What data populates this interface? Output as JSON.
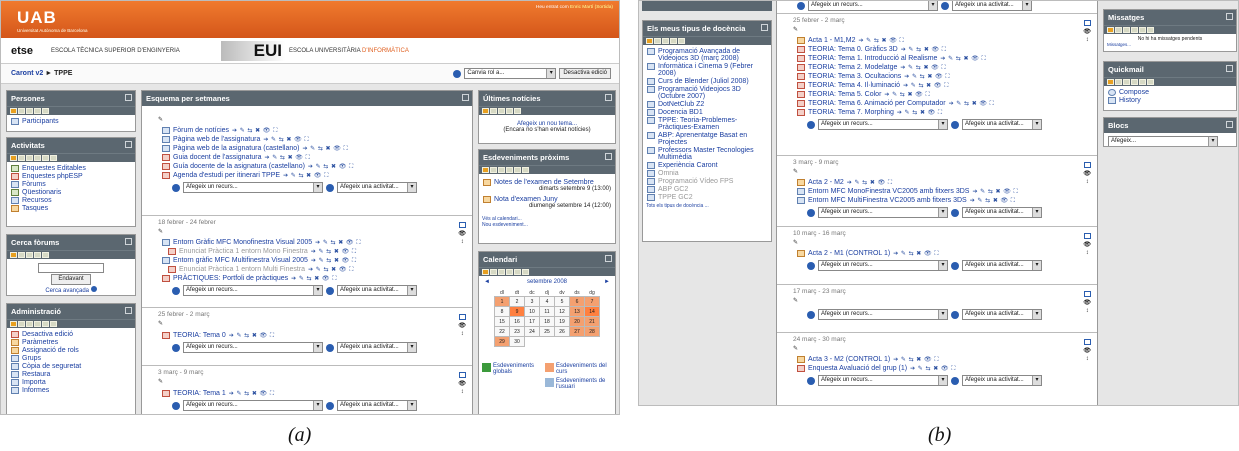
{
  "screens": {
    "a_caption": "(a)",
    "b_caption": "(b)"
  },
  "header": {
    "uab": "UAB",
    "uab_sub": "Universitat Autònoma de Barcelona",
    "welcome": "Heu entrat com",
    "user": "Enric Martí",
    "logout": "(Sortida)",
    "etse_logo": "etse",
    "etse_text": "ESCOLA TÈCNICA SUPERIOR D'ENGINYERIA",
    "eui_logo": "EUI",
    "eui_text": "ESCOLA UNIVERSITÀRIA",
    "eui_text_hl": "D'INFORMÀTICA"
  },
  "nav": {
    "home": "Caront v2",
    "arrow": "►",
    "course": "TPPE",
    "role_select": "Canvia rol a...",
    "edit_button": "Desactiva edició"
  },
  "blocks": {
    "persones": {
      "title": "Persones",
      "items": [
        "Participants"
      ]
    },
    "activitats": {
      "title": "Activitats",
      "items": [
        "Enquestes Editables",
        "Enquestes phpESP",
        "Fòrums",
        "Qüestionaris",
        "Recursos",
        "Tasques"
      ]
    },
    "cerca": {
      "title": "Cerca fòrums",
      "button": "Endavant",
      "advanced": "Cerca avançada"
    },
    "admin": {
      "title": "Administració",
      "items": [
        "Desactiva edició",
        "Paràmetres",
        "Assignació de rols",
        "Grups",
        "Còpia de seguretat",
        "Restaura",
        "Importa",
        "Informes"
      ]
    },
    "noticies": {
      "title": "Últimes notícies",
      "add": "Afegeix un nou tema...",
      "none": "(Encara no s'han enviat notícies)"
    },
    "esdev": {
      "title": "Esdeveniments pròxims",
      "e1": "Notes de l'examen de Setembre",
      "e1d": "dimarts setembre 9 (13:00)",
      "e2": "Nota d'examen Juny",
      "e2d": "diumenge setembre 14 (12:00)",
      "cal_link": "Vés al calendari...",
      "new_link": "Nou esdeveniment..."
    },
    "calendari": {
      "title": "Calendari",
      "prev": "◄",
      "month": "setembre 2008",
      "next": "►",
      "days": [
        "dl",
        "dt",
        "dc",
        "dj",
        "dv",
        "ds",
        "dg"
      ],
      "weeks": [
        [
          "1",
          "2",
          "3",
          "4",
          "5",
          "6",
          "7"
        ],
        [
          "8",
          "9",
          "10",
          "11",
          "12",
          "13",
          "14"
        ],
        [
          "15",
          "16",
          "17",
          "18",
          "19",
          "20",
          "21"
        ],
        [
          "22",
          "23",
          "24",
          "25",
          "26",
          "27",
          "28"
        ],
        [
          "29",
          "30",
          "",
          "",
          "",
          "",
          ""
        ]
      ],
      "legend_global": "Esdeveniments globals",
      "legend_course": "Esdeveniments del curs",
      "legend_user": "Esdeveniments de l'usuari"
    }
  },
  "main": {
    "title": "Esquema per setmanes",
    "acts": "➔ ✎ ⇆ ✖ 👁 ⛶",
    "add_resource": "Afegeix un recurs...",
    "add_activity": "Afegeix una activitat...",
    "intro": [
      "Fòrum de notícies",
      "Pàgina web de l'assignatura",
      "Pàgina web de la asignatura (castellano)",
      "Guia docent de l'assignatura",
      "Guía docente de la asignatura (castellano)",
      "Agenda d'estudi per itinerari TPPE"
    ],
    "w1": {
      "date": "18 febrer - 24 febrer",
      "items": [
        "Entorn Gràfic MFC Monofinestra Visual 2005",
        "Enunciat Pràctica 1 entorn Mono Finestra",
        "Entorn gràfic MFC Multifinestra Visual 2005",
        "Enunciat Pràctica 1 entorn Multi Finestra",
        "PRÀCTIQUES: Portfoli de pràctiques"
      ]
    },
    "w2": {
      "date": "25 febrer - 2 març",
      "items": [
        "TEORIA: Tema 0"
      ]
    },
    "w3": {
      "date": "3 març - 9 març",
      "items": [
        "TEORIA: Tema 1"
      ]
    }
  },
  "b": {
    "tipus": {
      "title": "Els meus tipus de docència",
      "items": [
        "Programació Avançada de Videojocs 3D (març 2008)",
        "Informàtica i Cinema 9 (Febrer 2008)",
        "Curs de Blender (Juliol 2008)",
        "Programació Videojocs 3D (Octubre 2007)",
        "DotNetClub Z2",
        "Docencia BD1",
        "TPPE: Teoria-Problemes-Pràctiques-Examen",
        "ABP: Aprenentatge Basat en Projectes",
        "Professors Master Tecnologies Multimèdia",
        "Experiència Caront",
        "Omnia",
        "Programació Vídeo FPS",
        "ABP GC2",
        "TPPE GC2"
      ],
      "all": "Tots els tipus de docència ..."
    },
    "w1": {
      "date": "25 febrer - 2 març",
      "items": [
        "Acta 1 - M1,M2",
        "TEORIA: Tema 0. Gràfics 3D",
        "TEORIA: Tema 1. Introducció al Realisme",
        "TEORIA: Tema 2. Modelatge",
        "TEORIA: Tema 3. Ocultacions",
        "TEORIA: Tema 4. Il·luminació",
        "TEORIA: Tema 5. Color",
        "TEORIA: Tema 6. Animació per Computador",
        "TEORIA: Tema 7. Morphing"
      ]
    },
    "w2": {
      "date": "3 març - 9 març",
      "items": [
        "Acta 2 - M2",
        "Entorn MFC MonoFinestra VC2005 amb fitxers 3DS",
        "Entorn MFC MultiFinestra VC2005 amb fitxers 3DS"
      ]
    },
    "w3": {
      "date": "10 març - 16 març",
      "items": [
        "Acta 2 - M1 (CONTROL 1)"
      ]
    },
    "w4": {
      "date": "17 març - 23 març",
      "items": []
    },
    "w5": {
      "date": "24 març - 30 març",
      "items": [
        "Acta 3 - M2 (CONTROL 1)",
        "Enquesta Avaluació del grup (1)"
      ]
    },
    "missatges": {
      "title": "Missatges",
      "none": "No hi ha missatges pendents",
      "link": "Missatges..."
    },
    "quickmail": {
      "title": "Quickmail",
      "items": [
        "Compose",
        "History"
      ]
    },
    "blocs": {
      "title": "Blocs",
      "select": "Afegeix..."
    }
  }
}
